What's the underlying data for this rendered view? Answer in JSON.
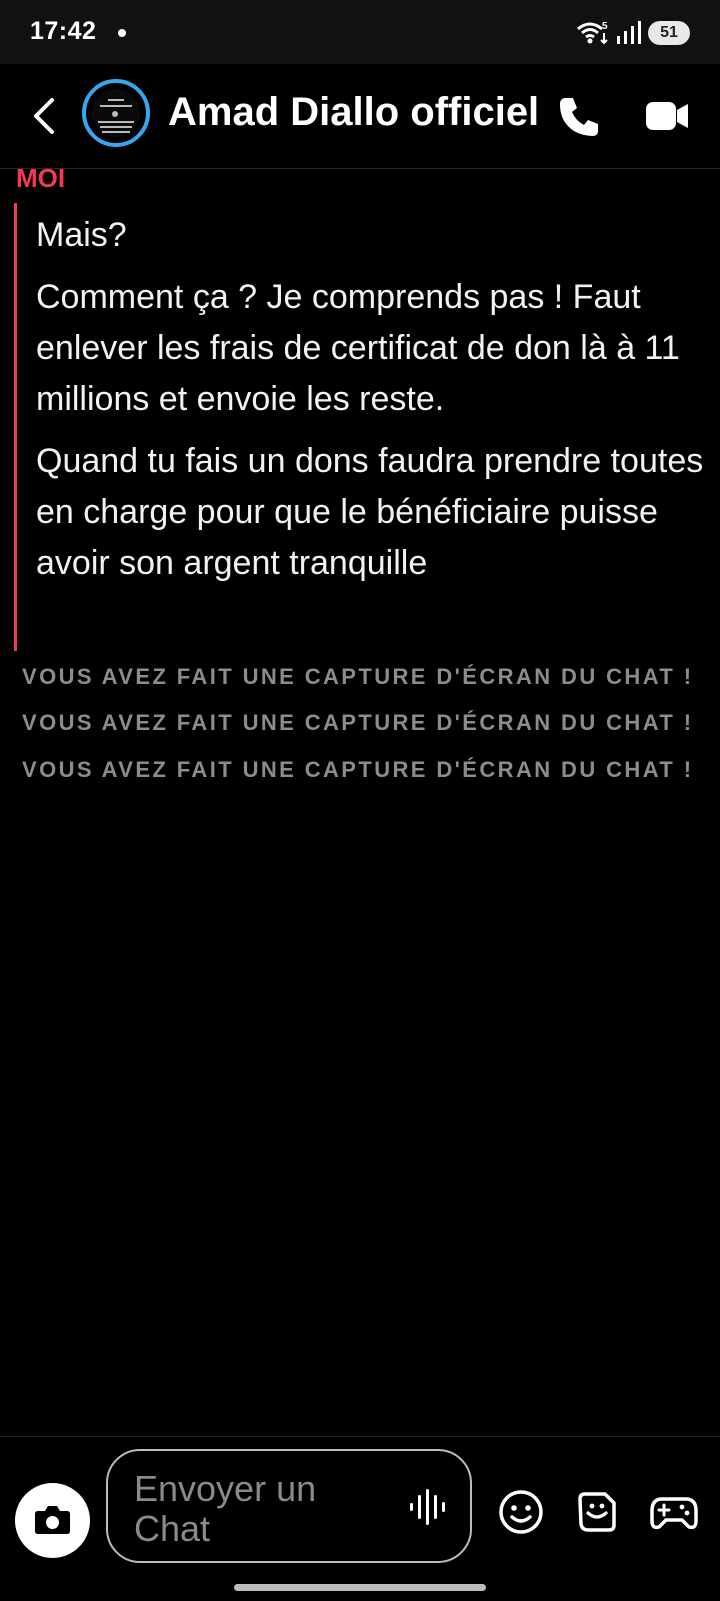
{
  "status_bar": {
    "time": "17:42",
    "battery": "51",
    "network_badge": "5"
  },
  "header": {
    "contact_name": "Amad Diallo officiel"
  },
  "messages": {
    "sender": "MOI",
    "items": [
      "Mais?",
      "Comment ça ? Je comprends pas ! Faut enlever les frais de certificat de don là à 11 millions et envoie les reste.",
      "Quand tu fais un dons faudra prendre toutes en charge pour que le bénéficiaire puisse avoir son argent tranquille"
    ]
  },
  "notices": [
    "VOUS AVEZ FAIT UNE CAPTURE D'ÉCRAN DU CHAT !",
    "VOUS AVEZ FAIT UNE CAPTURE D'ÉCRAN DU CHAT !",
    "VOUS AVEZ FAIT UNE CAPTURE D'ÉCRAN DU CHAT !"
  ],
  "composer": {
    "placeholder": "Envoyer un Chat"
  },
  "colors": {
    "accent": "#f2394d",
    "avatar_ring": "#34a7f0",
    "background": "#000000"
  },
  "icons": [
    "back-icon",
    "phone-icon",
    "video-icon",
    "camera-icon",
    "voice-icon",
    "emoji-icon",
    "sticker-icon",
    "game-icon"
  ]
}
